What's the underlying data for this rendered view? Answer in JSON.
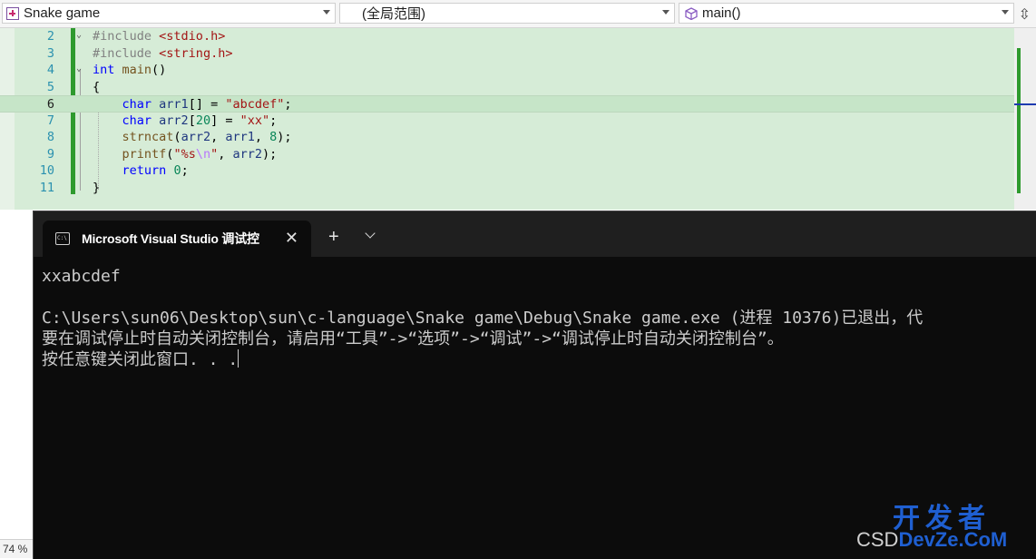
{
  "navbar": {
    "project": "Snake game",
    "scope": "(全局范围)",
    "member": "main()"
  },
  "editor": {
    "lines": [
      {
        "num": "2"
      },
      {
        "num": "3"
      },
      {
        "num": "4"
      },
      {
        "num": "5"
      },
      {
        "num": "6"
      },
      {
        "num": "7"
      },
      {
        "num": "8"
      },
      {
        "num": "9"
      },
      {
        "num": "10"
      },
      {
        "num": "11"
      }
    ]
  },
  "console": {
    "tab_title": "Microsoft Visual Studio 调试控",
    "output": [
      "xxabcdef",
      "C:\\Users\\sun06\\Desktop\\sun\\c-language\\Snake game\\Debug\\Snake game.exe (进程 10376)已退出，代",
      "要在调试停止时自动关闭控制台，请启用“工具”->“选项”->“调试”->“调试停止时自动关闭控制台”。",
      "按任意键关闭此窗口. . ."
    ]
  },
  "statusbar": {
    "zoom": "74 %"
  },
  "watermark": {
    "top": "开发者",
    "bottom_left": "CSD",
    "bottom_brand": "DevZe.CoM"
  },
  "icons": {
    "project": "project-icon",
    "member": "cube-icon",
    "console": "cmd-icon",
    "close": "close-icon",
    "new_tab": "plus-icon",
    "tab_menu": "chevron-down-icon"
  }
}
